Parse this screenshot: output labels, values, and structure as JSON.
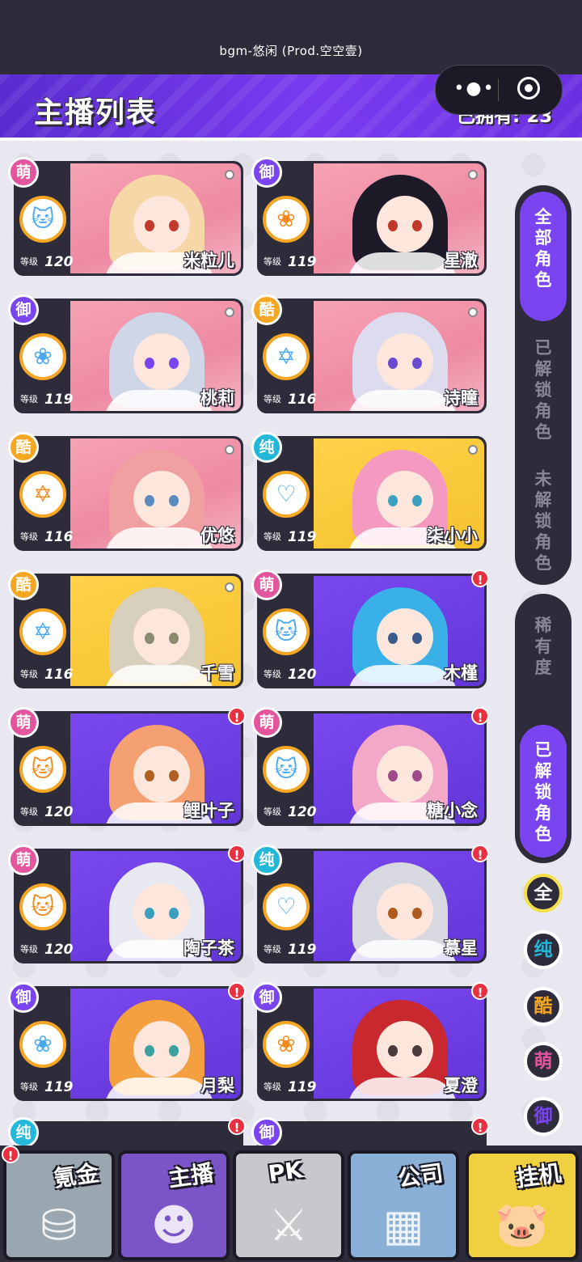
{
  "status": {
    "music": "bgm-悠闲 (Prod.空空壹)"
  },
  "header": {
    "title": "主播列表",
    "owned": "已拥有: 23"
  },
  "capsule": {
    "menu_icon": "dots-icon",
    "close_icon": "target-icon"
  },
  "level_label": "等级",
  "streamers": [
    {
      "name": "米粒儿",
      "level": "120",
      "tag": "萌",
      "tag_class": "meng",
      "bg": "pink",
      "hair": "#f6d8a8",
      "eye": "#c0392b",
      "emblem": "cat-icon",
      "emblem_glyph": "🐱",
      "emblem_color": "blue",
      "badge": "dot"
    },
    {
      "name": "星澈",
      "level": "119",
      "tag": "御",
      "tag_class": "yu",
      "bg": "pink",
      "hair": "#1c1a26",
      "eye": "#c0392b",
      "emblem": "rose-icon",
      "emblem_glyph": "❀",
      "emblem_color": "orange",
      "badge": "dot"
    },
    {
      "name": "桃莉",
      "level": "119",
      "tag": "御",
      "tag_class": "yu",
      "bg": "pink",
      "hair": "#cfd6e8",
      "eye": "#7a45f0",
      "emblem": "rose-icon",
      "emblem_glyph": "❀",
      "emblem_color": "blue",
      "badge": "dot"
    },
    {
      "name": "诗瞳",
      "level": "116",
      "tag": "酷",
      "tag_class": "ku",
      "bg": "pink",
      "hair": "#dcdcee",
      "eye": "#6a4ad0",
      "emblem": "star-icon",
      "emblem_glyph": "✡",
      "emblem_color": "blue",
      "badge": "dot"
    },
    {
      "name": "优悠",
      "level": "116",
      "tag": "酷",
      "tag_class": "ku",
      "bg": "pink",
      "hair": "#f0a0a0",
      "eye": "#5a8ac0",
      "emblem": "star-icon",
      "emblem_glyph": "✡",
      "emblem_color": "orange",
      "badge": "dot"
    },
    {
      "name": "柒小小",
      "level": "119",
      "tag": "纯",
      "tag_class": "chun",
      "bg": "yellow",
      "hair": "#f49ac0",
      "eye": "#3aa0c0",
      "emblem": "heartbeat-icon",
      "emblem_glyph": "♡",
      "emblem_color": "blue",
      "badge": "dot"
    },
    {
      "name": "千雪",
      "level": "116",
      "tag": "酷",
      "tag_class": "ku",
      "bg": "yellow",
      "hair": "#d8d0bc",
      "eye": "#8a8a70",
      "emblem": "star-icon",
      "emblem_glyph": "✡",
      "emblem_color": "blue",
      "badge": "none"
    },
    {
      "name": "木槿",
      "level": "120",
      "tag": "萌",
      "tag_class": "meng",
      "bg": "purple",
      "hair": "#3ab0e8",
      "eye": "#3a5a8a",
      "emblem": "cat-icon",
      "emblem_glyph": "🐱",
      "emblem_color": "blue",
      "badge": "alert"
    },
    {
      "name": "鲤叶子",
      "level": "120",
      "tag": "萌",
      "tag_class": "meng",
      "bg": "purple",
      "hair": "#f5a070",
      "eye": "#b06020",
      "emblem": "cat-icon",
      "emblem_glyph": "🐱",
      "emblem_color": "orange",
      "badge": "alert"
    },
    {
      "name": "糖小念",
      "level": "120",
      "tag": "萌",
      "tag_class": "meng",
      "bg": "purple",
      "hair": "#f4a8c8",
      "eye": "#a04a8a",
      "emblem": "cat-icon",
      "emblem_glyph": "🐱",
      "emblem_color": "blue",
      "badge": "alert"
    },
    {
      "name": "陶子茶",
      "level": "120",
      "tag": "萌",
      "tag_class": "meng",
      "bg": "purple",
      "hair": "#e8e8f0",
      "eye": "#3aa0c0",
      "emblem": "cat-icon",
      "emblem_glyph": "🐱",
      "emblem_color": "orange",
      "badge": "alert"
    },
    {
      "name": "慕星",
      "level": "119",
      "tag": "纯",
      "tag_class": "chun",
      "bg": "purple",
      "hair": "#d8d8e0",
      "eye": "#b05a20",
      "emblem": "heartbeat-icon",
      "emblem_glyph": "♡",
      "emblem_color": "blue",
      "badge": "alert"
    },
    {
      "name": "月梨",
      "level": "119",
      "tag": "御",
      "tag_class": "yu",
      "bg": "purple",
      "hair": "#f5a040",
      "eye": "#3aa0a0",
      "emblem": "rose-icon",
      "emblem_glyph": "❀",
      "emblem_color": "blue",
      "badge": "alert"
    },
    {
      "name": "夏澄",
      "level": "119",
      "tag": "御",
      "tag_class": "yu",
      "bg": "purple",
      "hair": "#c8282e",
      "eye": "#4a3a3a",
      "emblem": "rose-icon",
      "emblem_glyph": "❀",
      "emblem_color": "orange",
      "badge": "alert"
    }
  ],
  "partial_tags": [
    "纯",
    "御"
  ],
  "side_filters": {
    "tab_all": "全部角色",
    "tab_unlocked": "已解锁角色",
    "tab_locked": "未解锁角色",
    "rarity": "稀有度",
    "rarity_unlocked": "已解锁角色"
  },
  "type_filters": [
    {
      "label": "全",
      "color": "#ffffff"
    },
    {
      "label": "纯",
      "color": "#23b7d9"
    },
    {
      "label": "酷",
      "color": "#f5a623"
    },
    {
      "label": "萌",
      "color": "#e3569e"
    },
    {
      "label": "御",
      "color": "#7a45f0"
    }
  ],
  "bottom_nav": [
    {
      "label": "氪金",
      "icon": "coins-icon",
      "glyph": "⛁",
      "bg": "#9aa6b0"
    },
    {
      "label": "主播",
      "icon": "streamer-icon",
      "glyph": "☻",
      "bg": "#7a55c8"
    },
    {
      "label": "PK",
      "icon": "pk-icon",
      "glyph": "⚔",
      "bg": "#c8c8cc"
    },
    {
      "label": "公司",
      "icon": "building-icon",
      "glyph": "▦",
      "bg": "#8ab0d8"
    },
    {
      "label": "挂机",
      "icon": "piggybank-icon",
      "glyph": "🐷",
      "bg": "#f0d040"
    }
  ]
}
